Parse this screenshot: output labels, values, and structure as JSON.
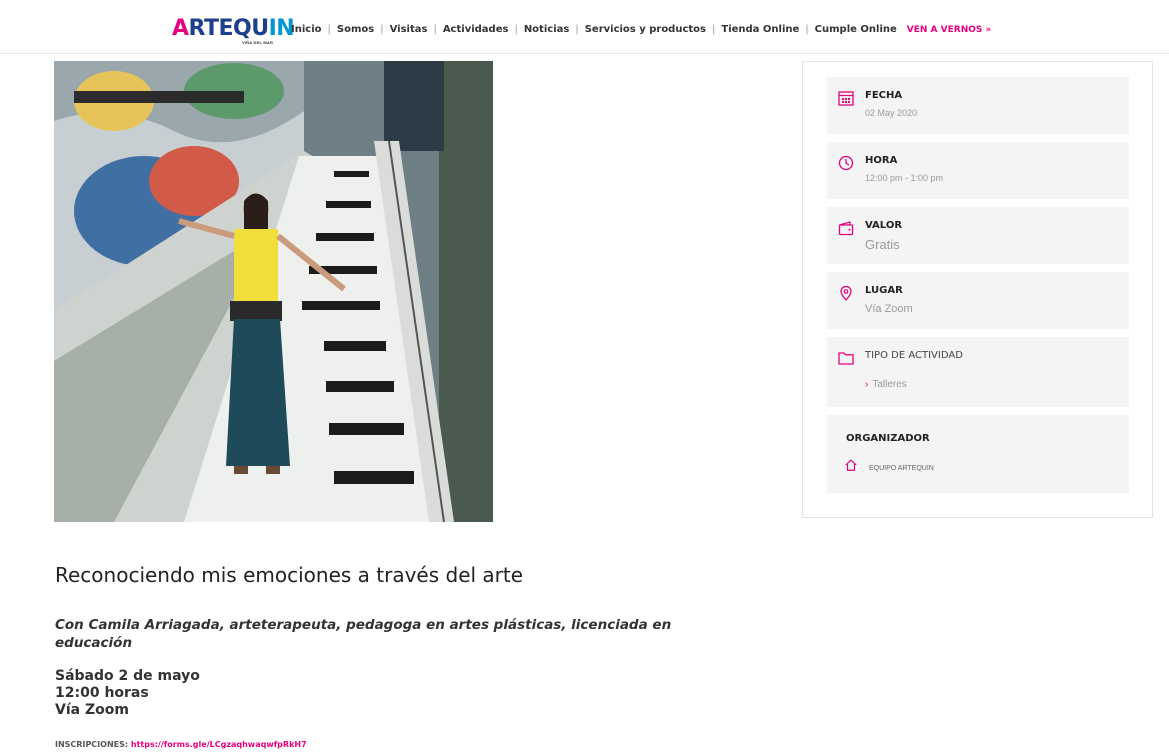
{
  "header": {
    "logo": {
      "main": "ARTEQUIN",
      "sub": "VIÑA DEL MAR"
    },
    "nav": [
      "Inicio",
      "Somos",
      "Visitas",
      "Actividades",
      "Noticias",
      "Servicios y productos",
      "Tienda Online",
      "Cumple Online"
    ],
    "cta": "VEN A VERNOS »"
  },
  "photo": {
    "icon": "event-photo"
  },
  "sidebar": {
    "fecha": {
      "label": "FECHA",
      "value": "02 May 2020",
      "icon": "calendar-icon"
    },
    "hora": {
      "label": "HORA",
      "value": "12:00 pm - 1:00 pm",
      "icon": "clock-icon"
    },
    "valor": {
      "label": "VALOR",
      "value": "Gratis",
      "icon": "wallet-icon"
    },
    "lugar": {
      "label": "LUGAR",
      "value": "Vía Zoom",
      "icon": "location-pin-icon"
    },
    "tipo": {
      "label": "TIPO DE ACTIVIDAD",
      "value": "Talleres",
      "icon": "folder-icon"
    },
    "organizador": {
      "label": "ORGANIZADOR",
      "value": "EQUIPO ARTEQUIN",
      "icon": "home-icon"
    }
  },
  "event": {
    "title": "Reconociendo mis emociones a través del arte",
    "subtitle": "Con Camila Arriagada, arteterapeuta, pedagoga en artes plásticas, licenciada en educación",
    "date": "Sábado 2 de mayo",
    "time": "12:00 horas",
    "place": "Vía Zoom",
    "inscripciones_label": "INSCRIPCIONES:",
    "inscripciones_url": "https://forms.gle/LCgzaqhwaqwfpRkH7"
  },
  "colors": {
    "accent": "#e6007e",
    "logo_blue": "#1d3f8c",
    "logo_cyan": "#0096d6",
    "panel": "#f4f4f4"
  }
}
